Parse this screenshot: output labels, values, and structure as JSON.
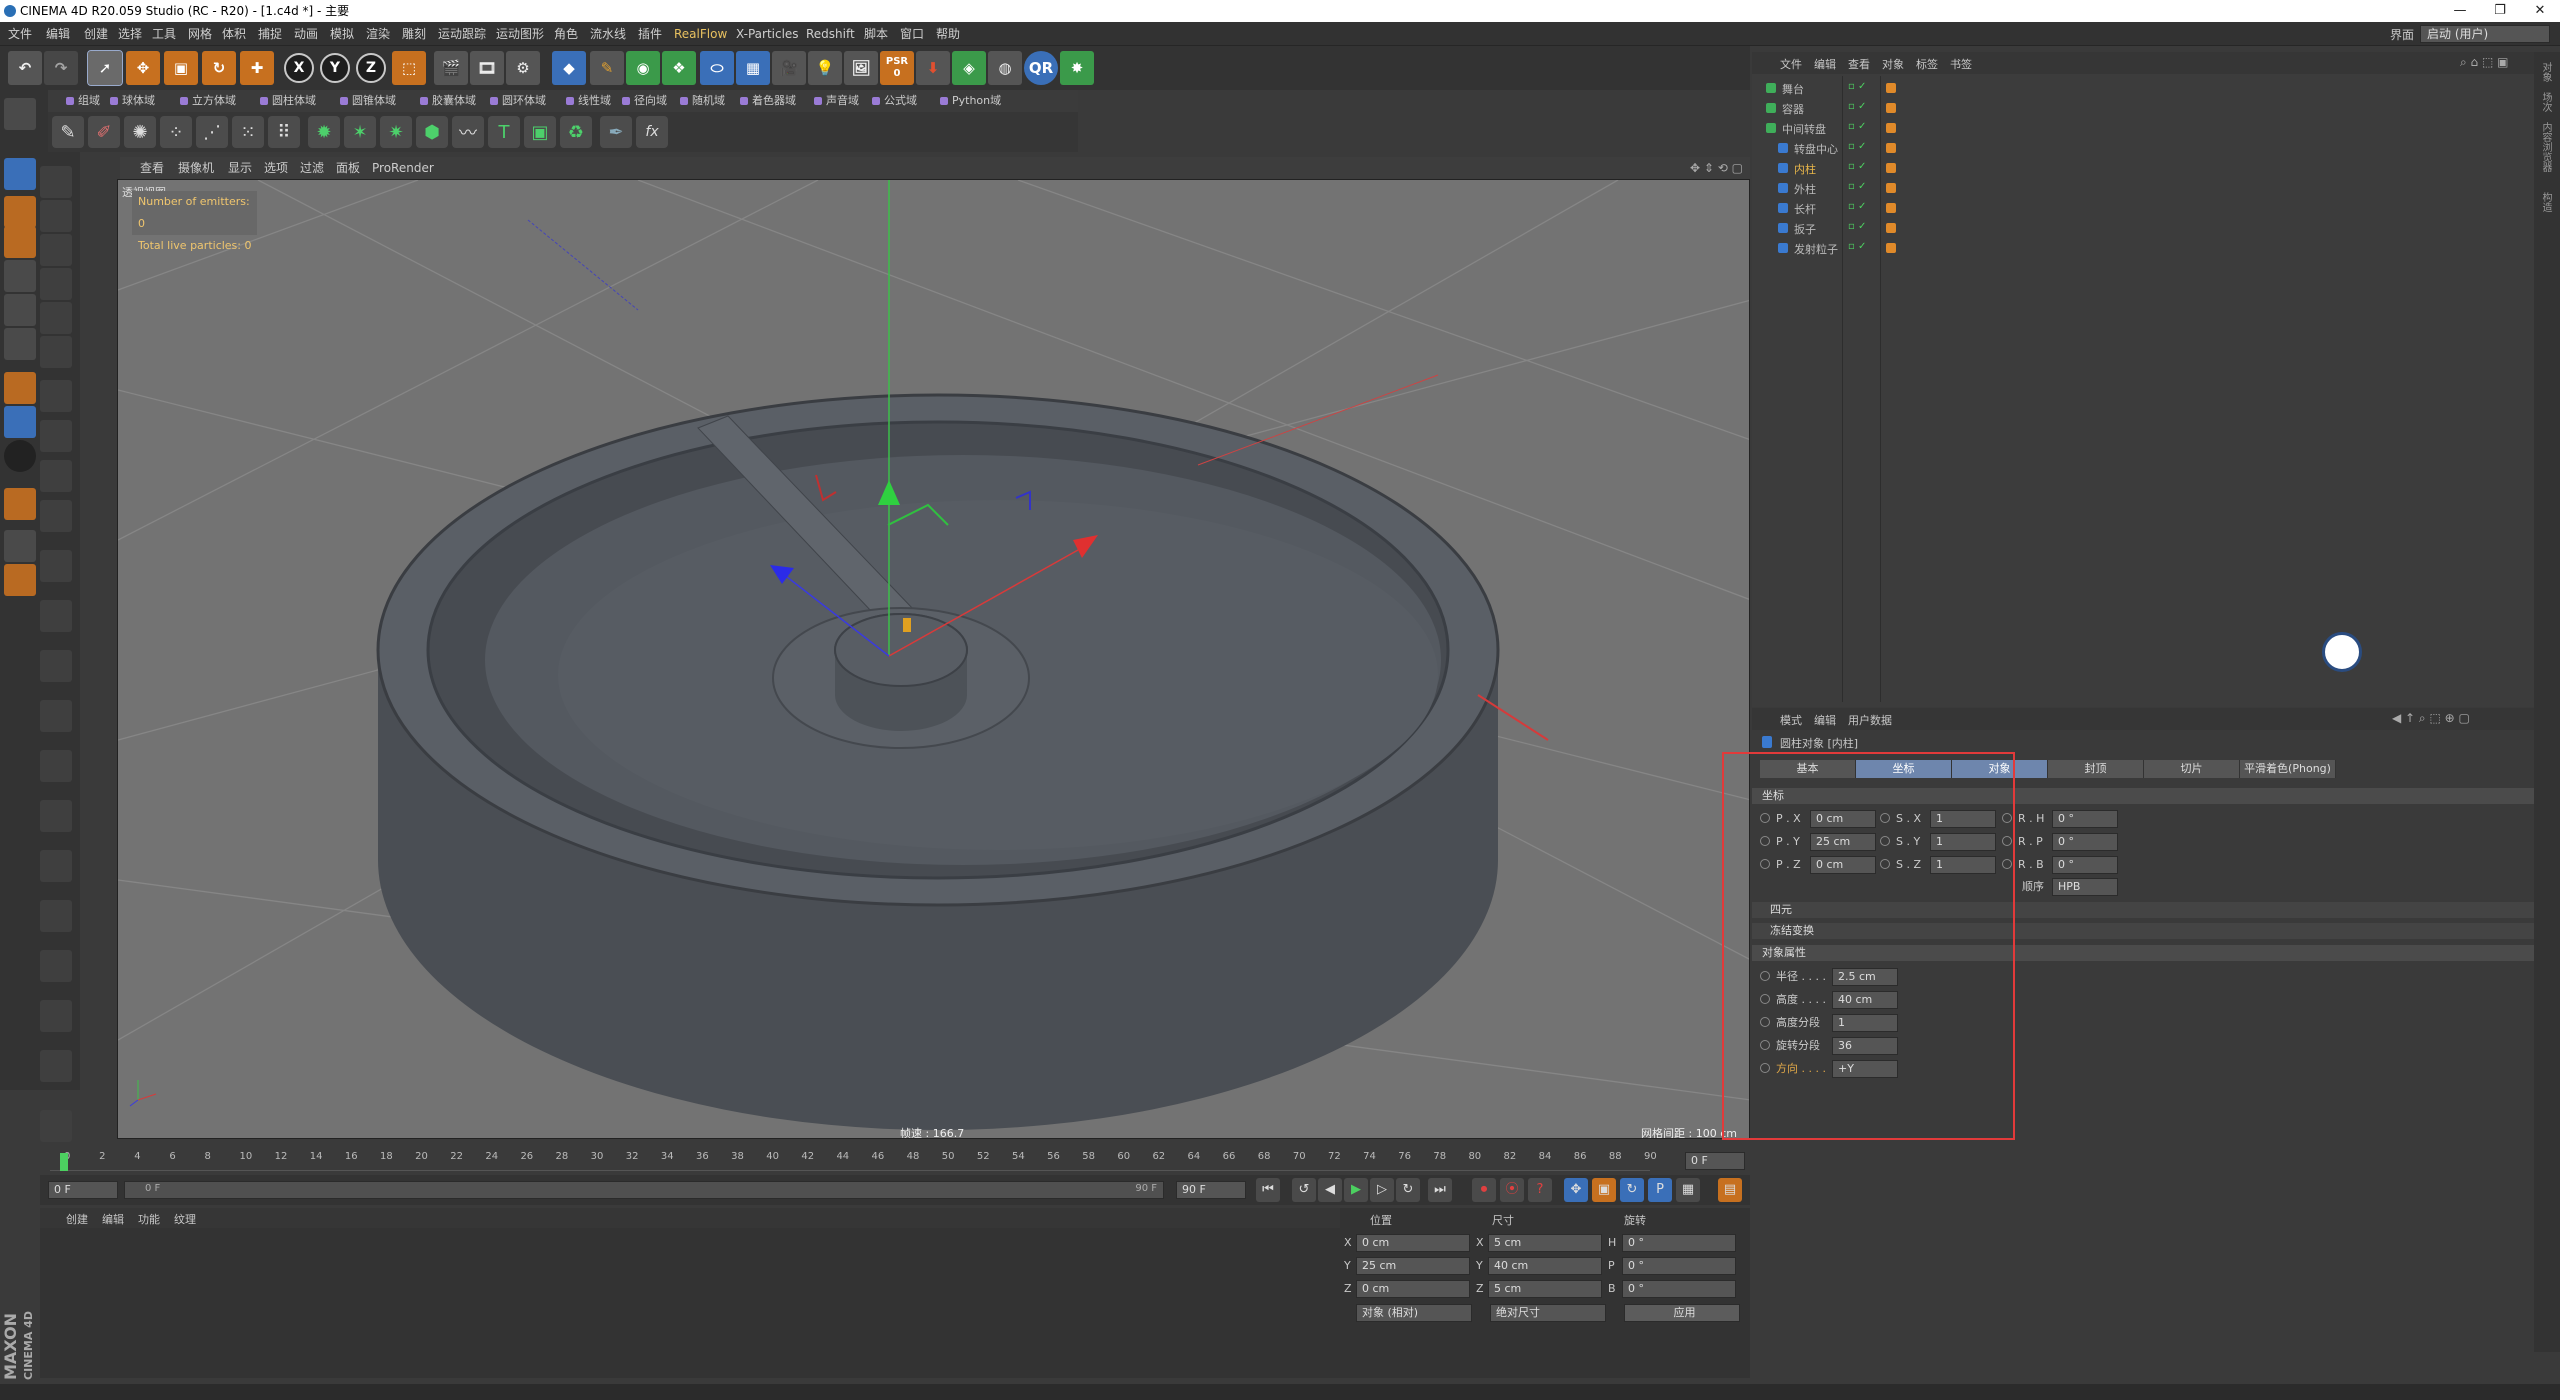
{
  "titlebar": {
    "title": "CINEMA 4D R20.059 Studio (RC - R20) - [1.c4d *] - 主要"
  },
  "menubar": {
    "items": [
      "文件",
      "编辑",
      "创建",
      "选择",
      "工具",
      "网格",
      "体积",
      "捕捉",
      "动画",
      "模拟",
      "渲染",
      "雕刻",
      "运动跟踪",
      "运动图形",
      "角色",
      "流水线",
      "插件",
      "RealFlow",
      "X-Particles",
      "Redshift",
      "脚本",
      "窗口",
      "帮助"
    ],
    "layout_label": "界面",
    "layout_value": "启动 (用户)"
  },
  "toolbar1": {
    "axis_labels": [
      "X",
      "Y",
      "Z"
    ],
    "psr_label": "PSR",
    "psr_value": "0",
    "qr_label": "QR"
  },
  "toolbar2": {
    "items": [
      "组域",
      "球体域",
      "立方体域",
      "圆柱体域",
      "圆锥体域",
      "胶囊体域",
      "圆环体域",
      "线性域",
      "径向域",
      "随机域",
      "着色器域",
      "声音域",
      "公式域",
      "Python域"
    ]
  },
  "viewport": {
    "menu": [
      "查看",
      "摄像机",
      "显示",
      "选项",
      "过滤",
      "面板",
      "ProRender"
    ],
    "hud_emitters": "Number of emitters: 0",
    "hud_particles": "Total live particles: 0",
    "persp_label": "透视视图",
    "fps": "帧速 : 166.7",
    "grid": "网格间距 : 100 cm",
    "bg_color": "#737373",
    "object_color": "#4e5258"
  },
  "timeline": {
    "ticks": [
      "0",
      "2",
      "4",
      "6",
      "8",
      "10",
      "12",
      "14",
      "16",
      "18",
      "20",
      "22",
      "24",
      "26",
      "28",
      "30",
      "32",
      "34",
      "36",
      "38",
      "40",
      "42",
      "44",
      "46",
      "48",
      "50",
      "52",
      "54",
      "56",
      "58",
      "60",
      "62",
      "64",
      "66",
      "68",
      "70",
      "72",
      "74",
      "76",
      "78",
      "80",
      "82",
      "84",
      "86",
      "88",
      "90"
    ],
    "current_frame": "0 F"
  },
  "transport": {
    "start": "0 F",
    "range_start": "0 F",
    "range_end": "90 F",
    "end": "90 F"
  },
  "material": {
    "menu": [
      "创建",
      "编辑",
      "功能",
      "纹理"
    ]
  },
  "coords": {
    "headers": [
      "位置",
      "尺寸",
      "旋转"
    ],
    "rows": [
      {
        "axis": "X",
        "pos": "0 cm",
        "size_axis": "X",
        "size": "5 cm",
        "rot_axis": "H",
        "rot": "0 °"
      },
      {
        "axis": "Y",
        "pos": "25 cm",
        "size_axis": "Y",
        "size": "40 cm",
        "rot_axis": "P",
        "rot": "0 °"
      },
      {
        "axis": "Z",
        "pos": "0 cm",
        "size_axis": "Z",
        "size": "5 cm",
        "rot_axis": "B",
        "rot": "0 °"
      }
    ],
    "mode": "对象 (相对)",
    "size_mode": "绝对尺寸",
    "apply": "应用"
  },
  "objects": {
    "menu": [
      "文件",
      "编辑",
      "查看",
      "对象",
      "标签",
      "书签"
    ],
    "items": [
      {
        "name": "舞台",
        "color": "#bbbbbb",
        "indent": 0,
        "highlight": false
      },
      {
        "name": "容器",
        "color": "#bbbbbb",
        "indent": 0,
        "highlight": false
      },
      {
        "name": "中间转盘",
        "color": "#bbbbbb",
        "indent": 0,
        "highlight": false
      },
      {
        "name": "转盘中心",
        "color": "#bbbbbb",
        "indent": 1,
        "highlight": false
      },
      {
        "name": "内柱",
        "color": "#e8b64a",
        "indent": 1,
        "highlight": true
      },
      {
        "name": "外柱",
        "color": "#bbbbbb",
        "indent": 1,
        "highlight": false
      },
      {
        "name": "长杆",
        "color": "#bbbbbb",
        "indent": 1,
        "highlight": false
      },
      {
        "name": "扳子",
        "color": "#bbbbbb",
        "indent": 1,
        "highlight": false
      },
      {
        "name": "发射粒子",
        "color": "#bbbbbb",
        "indent": 1,
        "highlight": false
      }
    ]
  },
  "attributes": {
    "menu": [
      "模式",
      "编辑",
      "用户数据"
    ],
    "title": "圆柱对象 [内柱]",
    "tabs": [
      "基本",
      "坐标",
      "对象",
      "封顶",
      "切片",
      "平滑着色(Phong)"
    ],
    "active_tabs": [
      1,
      2
    ],
    "coord_section": "坐标",
    "coord_rows": [
      {
        "p_label": "P . X",
        "p": "0 cm",
        "s_label": "S . X",
        "s": "1",
        "r_label": "R . H",
        "r": "0 °"
      },
      {
        "p_label": "P . Y",
        "p": "25 cm",
        "s_label": "S . Y",
        "s": "1",
        "r_label": "R . P",
        "r": "0 °"
      },
      {
        "p_label": "P . Z",
        "p": "0 cm",
        "s_label": "S . Z",
        "s": "1",
        "r_label": "R . B",
        "r": "0 °"
      }
    ],
    "order_label": "顺序",
    "order_value": "HPB",
    "quat": "四元",
    "freeze": "冻结变换",
    "object_section": "对象属性",
    "props": [
      {
        "label": "半径 . . . .",
        "value": "2.5 cm"
      },
      {
        "label": "高度 . . . .",
        "value": "40 cm"
      },
      {
        "label": "高度分段",
        "value": "1"
      },
      {
        "label": "旋转分段",
        "value": "36"
      },
      {
        "label": "方向 . . . .",
        "value": "+Y"
      }
    ]
  },
  "sidebar": {
    "tabs": [
      "对象",
      "场次",
      "内容浏览器",
      "构造"
    ]
  },
  "brand": {
    "maxon": "MAXON",
    "c4d": "CINEMA 4D"
  }
}
